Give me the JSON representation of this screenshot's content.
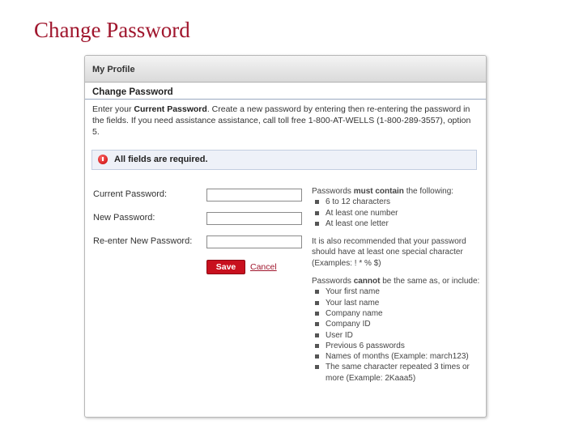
{
  "page": {
    "title": "Change Password"
  },
  "panel": {
    "header": "My Profile",
    "section_title": "Change Password",
    "intro": {
      "part1": "Enter your ",
      "bold": "Current Password",
      "part2": ". Create a new password by entering then re-entering the password in the fields. If you need assistance assistance, call toll free 1-800-AT-WELLS (1-800-289-3557), option 5."
    },
    "alert": {
      "text": "All fields are required."
    }
  },
  "form": {
    "current_password_label": "Current Password:",
    "current_password_value": "",
    "new_password_label": "New Password:",
    "new_password_value": "",
    "reenter_password_label": "Re-enter New Password:",
    "reenter_password_value": "",
    "save_label": "Save",
    "cancel_label": "Cancel"
  },
  "rules": {
    "must_prefix": "Passwords ",
    "must_bold": "must contain",
    "must_suffix": " the following:",
    "must_items": [
      "6 to 12 characters",
      "At least one number",
      "At least one letter"
    ],
    "recommend": "It is also recommended that your password should have at least one special character (Examples: ! * % $)",
    "cannot_prefix": "Passwords ",
    "cannot_bold": "cannot",
    "cannot_suffix": " be the same as, or include:",
    "cannot_items": [
      "Your first name",
      "Your last name",
      "Company name",
      "Company ID",
      "User ID",
      "Previous 6 passwords",
      "Names of months (Example: march123)",
      "The same character repeated 3 times or more (Example: 2Kaaa5)"
    ]
  },
  "colors": {
    "brand": "#a0162d",
    "save_button": "#c8101e",
    "alert_bg": "#eef1f8"
  },
  "icons": {
    "alert": "error-circle-icon",
    "bullet": "square-bullet-icon"
  }
}
